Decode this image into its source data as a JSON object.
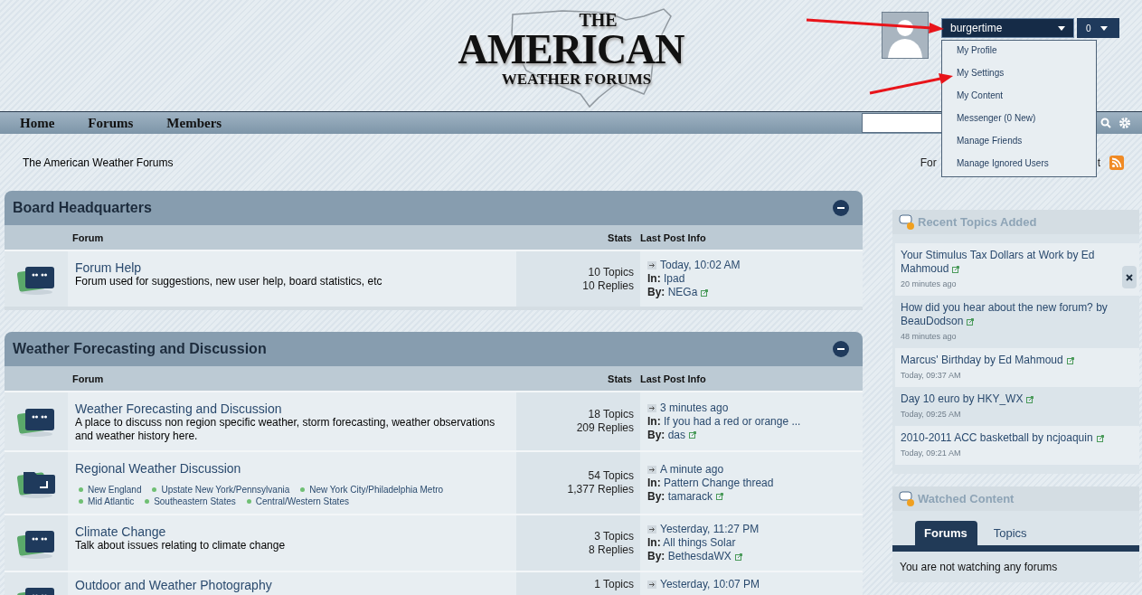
{
  "header": {
    "logo": {
      "line1": "THE",
      "line2": "AMERICAN",
      "line3": "WEATHER FORUMS"
    },
    "user_menu": {
      "username": "burgertime",
      "notifications": "0",
      "expanded": true,
      "items": [
        "My Profile",
        "My Settings",
        "My Content",
        "Messenger (0 New)",
        "Manage Friends",
        "Manage Ignored Users"
      ]
    }
  },
  "nav": {
    "items": [
      "Home",
      "Forums",
      "Members"
    ]
  },
  "breadcrumb": {
    "text": "The American Weather Forums",
    "right_parts": [
      "For",
      "t"
    ]
  },
  "categories": [
    {
      "title": "Board Headquarters",
      "columns": [
        "Forum",
        "Stats",
        "Last Post Info"
      ],
      "forums": [
        {
          "kind": "quotes",
          "name": "Forum Help",
          "description": "Forum used for suggestions, new user help, board statistics, etc",
          "topics": "10 Topics",
          "replies": "10 Replies",
          "last_post": {
            "date": "Today, 10:02 AM",
            "in_label": "In:",
            "topic": "Ipad",
            "by_label": "By:",
            "user": "NEGa"
          }
        }
      ]
    },
    {
      "title": "Weather Forecasting and Discussion",
      "columns": [
        "Forum",
        "Stats",
        "Last Post Info"
      ],
      "forums": [
        {
          "kind": "quotes",
          "name": "Weather Forecasting and Discussion",
          "description": "A place to discuss non region specific weather, storm forecasting, weather observations and weather history here.",
          "topics": "18 Topics",
          "replies": "209 Replies",
          "last_post": {
            "date": "3 minutes ago",
            "in_label": "In:",
            "topic": "If you had a red or orange ...",
            "by_label": "By:",
            "user": "das"
          }
        },
        {
          "kind": "folder",
          "name": "Regional Weather Discussion",
          "subforums": [
            "New England",
            "Upstate New York/Pennsylvania",
            "New York City/Philadelphia Metro",
            "Mid Atlantic",
            "Southeastern States",
            "Central/Western States"
          ],
          "topics": "54 Topics",
          "replies": "1,377 Replies",
          "last_post": {
            "date": "A minute ago",
            "in_label": "In:",
            "topic": "Pattern Change thread",
            "by_label": "By:",
            "user": "tamarack"
          }
        },
        {
          "kind": "quotes",
          "name": "Climate Change",
          "description": "Talk about issues relating to climate change",
          "topics": "3 Topics",
          "replies": "8 Replies",
          "last_post": {
            "date": "Yesterday, 11:27 PM",
            "in_label": "In:",
            "topic": "All things Solar",
            "by_label": "By:",
            "user": "BethesdaWX"
          }
        },
        {
          "kind": "quotes",
          "name": "Outdoor and Weather Photography",
          "topics": "1 Topics",
          "last_post": {
            "date": "Yesterday, 10:07 PM"
          }
        }
      ]
    }
  ],
  "sidebar": {
    "recent": {
      "title": "Recent Topics Added",
      "items": [
        {
          "title": "Your Stimulus Tax Dollars at Work by Ed Mahmoud",
          "time": "20 minutes ago"
        },
        {
          "title": "How did you hear about the new forum? by BeauDodson",
          "time": "48 minutes ago"
        },
        {
          "title": "Marcus' Birthday by Ed Mahmoud",
          "time": "Today, 09:37 AM"
        },
        {
          "title": "Day 10 euro by HKY_WX",
          "time": "Today, 09:25 AM"
        },
        {
          "title": "2010-2011 ACC basketball by ncjoaquin",
          "time": "Today, 09:21 AM"
        }
      ]
    },
    "watched": {
      "title": "Watched Content",
      "tabs": [
        {
          "label": "Forums",
          "selected": true
        },
        {
          "label": "Topics",
          "selected": false
        }
      ],
      "message": "You are not watching any forums"
    }
  }
}
